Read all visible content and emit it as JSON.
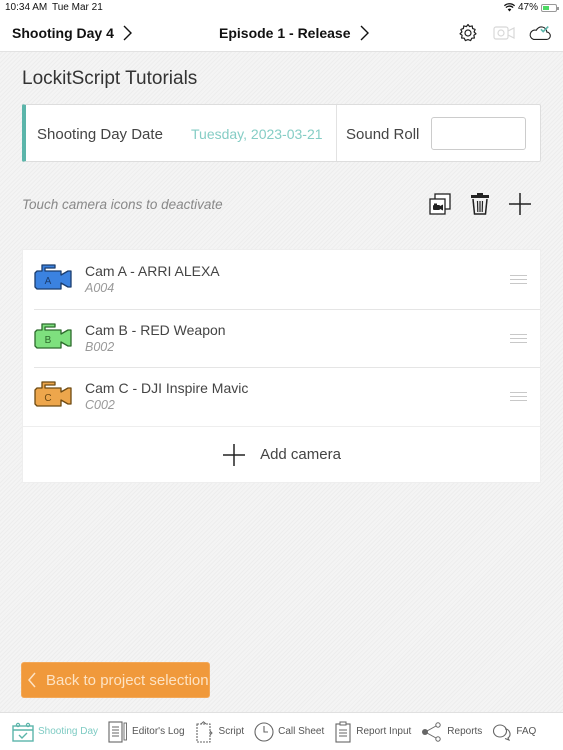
{
  "status_bar": {
    "time": "10:34 AM",
    "date": "Tue Mar 21",
    "battery": "47%"
  },
  "nav": {
    "shooting_day": "Shooting Day 4",
    "episode": "Episode 1 - Release",
    "icons": [
      "gear-icon",
      "camera-sync-icon",
      "cloud-check-icon"
    ]
  },
  "project": {
    "title": "LockitScript Tutorials"
  },
  "shooting_day_card": {
    "date_label": "Shooting Day Date",
    "date_value": "Tuesday, 2023-03-21",
    "sound_roll_label": "Sound Roll",
    "sound_roll_value": "",
    "sound_roll_placeholder": "",
    "accent_color": "#5bb5aa"
  },
  "cameras_section": {
    "hint": "Touch camera icons to deactivate",
    "toolbar_icons": [
      "copy-camera-icon",
      "trash-icon",
      "plus-icon"
    ],
    "cameras": [
      {
        "letter": "A",
        "name": "Cam A - ARRI ALEXA",
        "roll": "A004",
        "color": "#3b82e0"
      },
      {
        "letter": "B",
        "name": "Cam B - RED Weapon",
        "roll": "B002",
        "color": "#7ee07e"
      },
      {
        "letter": "C",
        "name": "Cam C - DJI Inspire Mavic",
        "roll": "C002",
        "color": "#eda64c"
      }
    ],
    "add_camera_label": "Add camera"
  },
  "back_button": {
    "label": "Back to project selection",
    "color": "#f0993b"
  },
  "tab_bar": {
    "tabs": [
      {
        "label": "Shooting Day",
        "icon": "calendar-check-icon",
        "active": true
      },
      {
        "label": "Editor's Log",
        "icon": "document-pen-icon",
        "active": false
      },
      {
        "label": "Script",
        "icon": "script-notebook-icon",
        "active": false
      },
      {
        "label": "Call Sheet",
        "icon": "clock-icon",
        "active": false
      },
      {
        "label": "Report Input",
        "icon": "clipboard-icon",
        "active": false
      },
      {
        "label": "Reports",
        "icon": "share-icon",
        "active": false
      },
      {
        "label": "FAQ",
        "icon": "chat-bubbles-icon",
        "active": false
      }
    ]
  }
}
